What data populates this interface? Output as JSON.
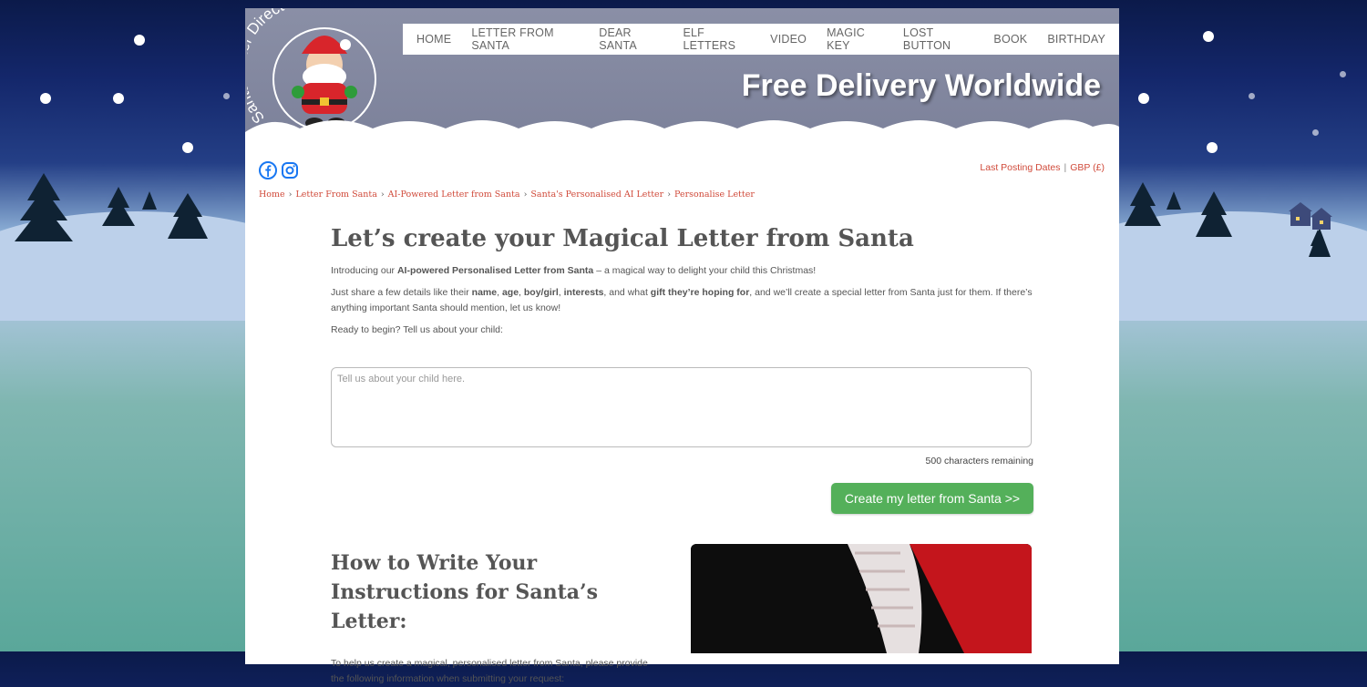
{
  "brand": {
    "logo_text": "Santa Letter Direct"
  },
  "nav": {
    "items": [
      "HOME",
      "LETTER FROM SANTA",
      "DEAR SANTA",
      "ELF LETTERS",
      "VIDEO",
      "MAGIC KEY",
      "LOST BUTTON",
      "BOOK",
      "BIRTHDAY"
    ]
  },
  "header": {
    "tagline": "Free Delivery Worldwide"
  },
  "util": {
    "posting": "Last Posting Dates",
    "separator": "|",
    "currency": "GBP (£)"
  },
  "breadcrumb": {
    "items": [
      "Home",
      "Letter From Santa",
      "AI-Powered Letter from Santa",
      "Santa's Personalised AI Letter",
      "Personalise Letter"
    ]
  },
  "main": {
    "title": "Let’s create your Magical Letter from Santa",
    "intro_prefix": "Introducing our ",
    "intro_bold": "AI-powered Personalised Letter from Santa",
    "intro_suffix": " – a magical way to delight your child this Christmas!",
    "share_1": "Just share a few details like their ",
    "share_name": "name",
    "share_2": ", ",
    "share_age": "age",
    "share_3": ", ",
    "share_boygirl": "boy/girl",
    "share_4": ", ",
    "share_interests": "interests",
    "share_5": ", and what ",
    "share_gift": "gift they’re hoping for",
    "share_6": ", and we’ll create a special letter from Santa just for them. If there’s anything important Santa should mention, let us know!",
    "ready": "Ready to begin? Tell us about your child:",
    "textarea_placeholder": "Tell us about your child here.",
    "chars_remaining": "500 characters remaining",
    "create_button": "Create my letter from Santa >>",
    "how_to_title": "How to Write Your Instructions for Santa’s Letter:",
    "how_to_text": "To help us create a magical, personalised letter from Santa, please provide the following information when submitting your request:"
  },
  "colors": {
    "accent_green": "#54b05a",
    "link_red": "#d04a3a",
    "header_grey": "#7c819a"
  }
}
